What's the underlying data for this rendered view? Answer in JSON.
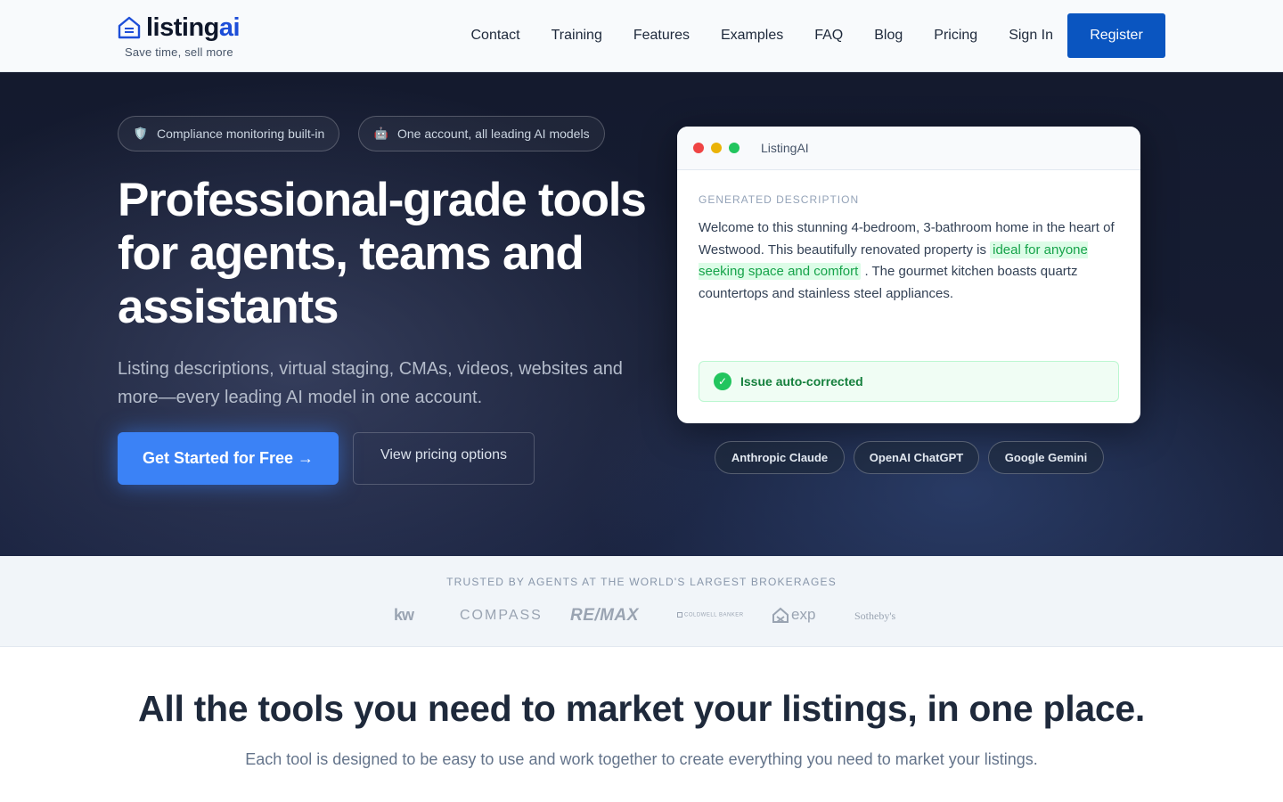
{
  "header": {
    "logo_text": "listing",
    "logo_ai": "ai",
    "tagline": "Save time, sell more",
    "nav": [
      "Contact",
      "Training",
      "Features",
      "Examples",
      "FAQ",
      "Blog",
      "Pricing",
      "Sign In"
    ],
    "register_label": "Register"
  },
  "hero": {
    "chips": [
      {
        "icon": "shield-icon",
        "glyph": "🛡️",
        "label": "Compliance monitoring built-in"
      },
      {
        "icon": "robot-icon",
        "glyph": "🤖",
        "label": "One account, all leading AI models"
      }
    ],
    "title": "Professional-grade tools for agents, teams and assistants",
    "subtitle": "Listing descriptions, virtual staging, CMAs, videos, websites and more—every leading AI model in one account.",
    "cta_primary": "Get Started for Free →",
    "cta_secondary": "View pricing options"
  },
  "preview": {
    "window_title": "ListingAI",
    "label": "GENERATED DESCRIPTION",
    "text_before": "Welcome to this stunning 4-bedroom, 3-bathroom home in the heart of Westwood. This beautifully renovated property is",
    "text_highlight": "ideal for anyone seeking space and comfort",
    "text_after": ". The gourmet kitchen boasts quartz countertops and stainless steel appliances.",
    "notice": "Issue auto-corrected",
    "check_glyph": "✓",
    "models": [
      "Anthropic Claude",
      "OpenAI ChatGPT",
      "Google Gemini"
    ]
  },
  "trust": {
    "label": "TRUSTED BY AGENTS AT THE WORLD'S LARGEST BROKERAGES",
    "brands": [
      "kw",
      "COMPASS",
      "RE/MAX",
      "COLDWELL BANKER",
      "exp",
      "Sotheby's"
    ]
  },
  "section": {
    "title": "All the tools you need to market your listings, in one place.",
    "subtitle": "Each tool is designed to be easy to use and work together to create everything you need to market your listings."
  },
  "colors": {
    "brand_blue": "#0a55c0",
    "cta_blue": "#3b82f6",
    "highlight_green": "#16a34a",
    "hero_bg": "#161d33"
  }
}
